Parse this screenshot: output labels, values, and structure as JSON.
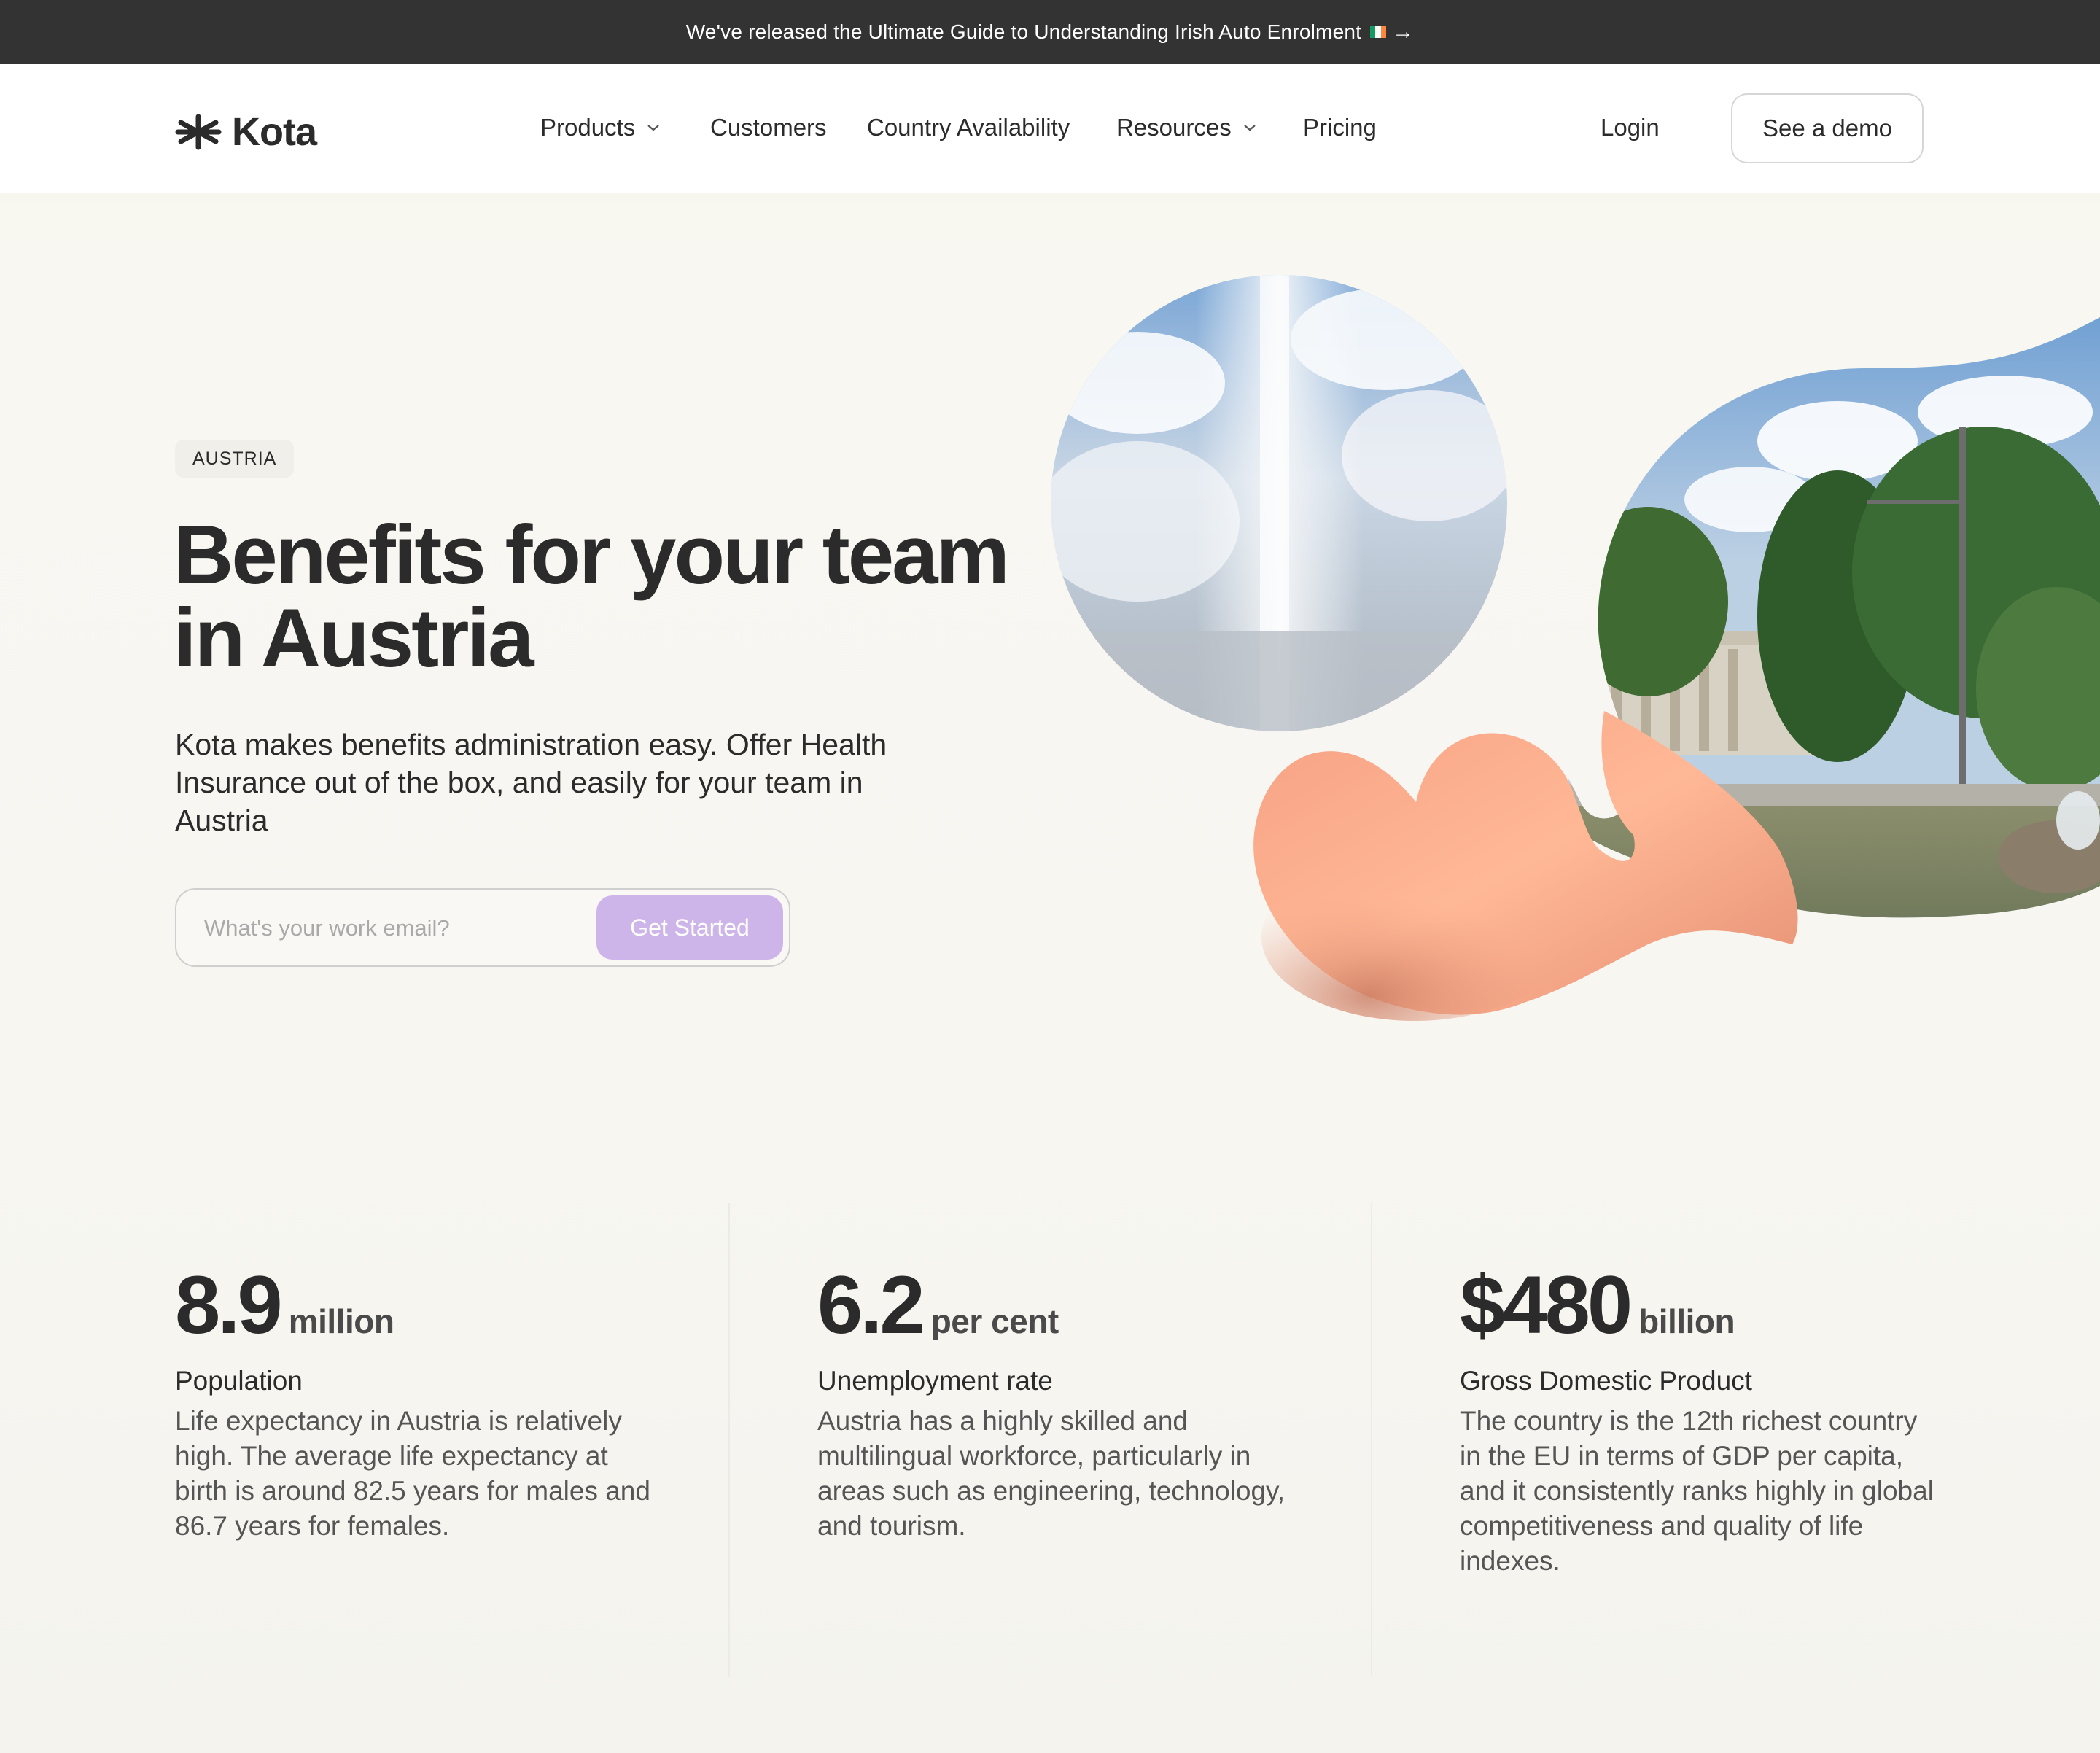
{
  "announcement": {
    "text": "We've released the Ultimate Guide to Understanding Irish Auto Enrolment",
    "arrow": "→",
    "flag_colors": [
      "#169b62",
      "#ffffff",
      "#ff883e"
    ]
  },
  "brand": {
    "name": "Kota",
    "logo_icon": "kota-asterisk-icon"
  },
  "nav": {
    "items": [
      {
        "label": "Products",
        "has_dropdown": true
      },
      {
        "label": "Customers",
        "has_dropdown": false
      },
      {
        "label": "Country Availability",
        "has_dropdown": false
      },
      {
        "label": "Resources",
        "has_dropdown": true
      },
      {
        "label": "Pricing",
        "has_dropdown": false
      }
    ],
    "login": "Login",
    "demo": "See a demo"
  },
  "hero": {
    "badge": "AUSTRIA",
    "title_line1": "Benefits for your team",
    "title_line2": "in Austria",
    "subtitle": "Kota makes benefits administration easy. Offer Health Insurance out of the box, and easily for your team in Austria",
    "email_placeholder": "What's your work email?",
    "cta": "Get Started",
    "colors": {
      "cta": "#cdb5ea",
      "peach": "#f7a98a"
    }
  },
  "stats": [
    {
      "number": "8.9",
      "unit": "million",
      "label": "Population",
      "description": "Life expectancy in Austria is relatively high. The average life expectancy at birth is around 82.5 years for males and 86.7 years for females."
    },
    {
      "number": "6.2",
      "unit": "per cent",
      "label": "Unemployment rate",
      "description": "Austria has a highly skilled and multilingual workforce, particularly in areas such as engineering, technology, and tourism."
    },
    {
      "number": "$480",
      "unit": "billion",
      "label": "Gross Domestic Product",
      "description": "The country is the 12th richest country in the EU in terms of GDP per capita, and it consistently ranks highly in global competitiveness and quality of life indexes."
    }
  ]
}
